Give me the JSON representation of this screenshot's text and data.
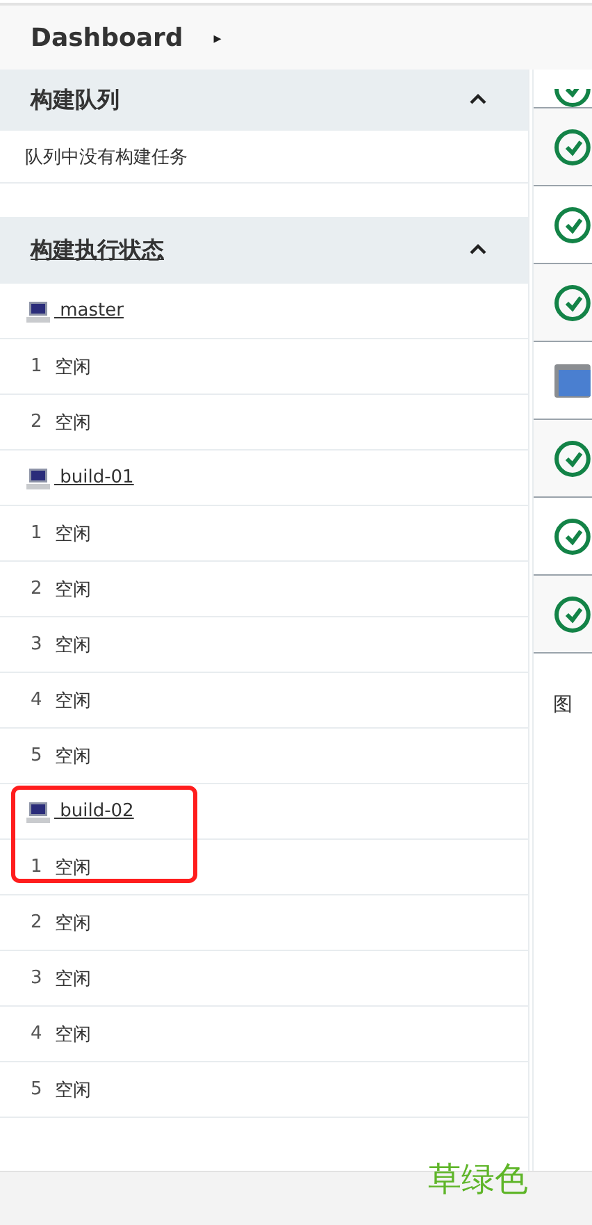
{
  "breadcrumb": {
    "title": "Dashboard",
    "separator": "▸"
  },
  "build_queue": {
    "title": "构建队列",
    "expanded": true,
    "empty_text": "队列中没有构建任务"
  },
  "executor_status": {
    "title": "构建执行状态",
    "expanded": true,
    "nodes": [
      {
        "name": "master",
        "highlighted": false,
        "executors": [
          {
            "number": "1",
            "status": "空闲"
          },
          {
            "number": "2",
            "status": "空闲"
          }
        ]
      },
      {
        "name": "build-01",
        "highlighted": false,
        "executors": [
          {
            "number": "1",
            "status": "空闲"
          },
          {
            "number": "2",
            "status": "空闲"
          },
          {
            "number": "3",
            "status": "空闲"
          },
          {
            "number": "4",
            "status": "空闲"
          },
          {
            "number": "5",
            "status": "空闲"
          }
        ]
      },
      {
        "name": "build-02",
        "highlighted": true,
        "executors": [
          {
            "number": "1",
            "status": "空闲"
          },
          {
            "number": "2",
            "status": "空闲"
          },
          {
            "number": "3",
            "status": "空闲"
          },
          {
            "number": "4",
            "status": "空闲"
          },
          {
            "number": "5",
            "status": "空闲"
          }
        ]
      }
    ]
  },
  "job_list": {
    "rows": [
      {
        "kind": "success"
      },
      {
        "kind": "success"
      },
      {
        "kind": "success"
      },
      {
        "kind": "success"
      },
      {
        "kind": "folder"
      },
      {
        "kind": "success"
      },
      {
        "kind": "success"
      },
      {
        "kind": "success"
      }
    ],
    "legend_text": "图"
  },
  "annotation": "草绿色"
}
